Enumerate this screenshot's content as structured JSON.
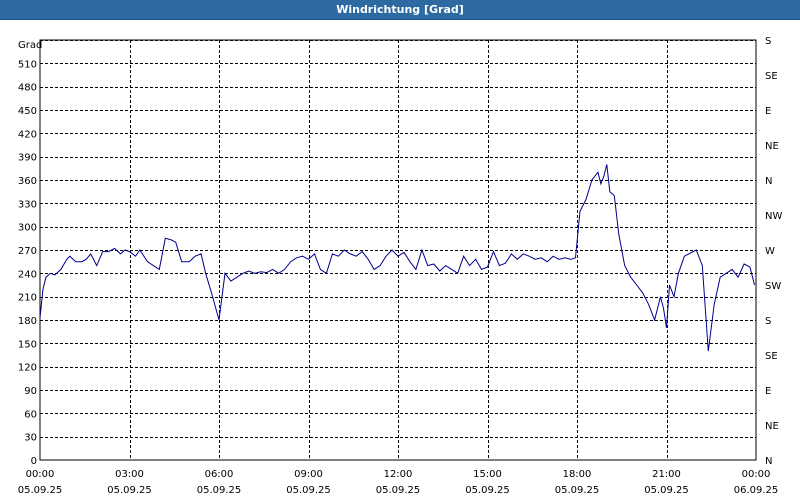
{
  "window": {
    "title": "Windrichtung [Grad]"
  },
  "chart_data": {
    "type": "line",
    "title": "Windrichtung [Grad]",
    "ylabel": "Grad",
    "ylim": [
      0,
      540
    ],
    "yticks": [
      0,
      30,
      60,
      90,
      120,
      150,
      180,
      210,
      240,
      270,
      300,
      330,
      360,
      390,
      420,
      450,
      480,
      510
    ],
    "right_axis_labels": [
      {
        "value": 0,
        "label": "N"
      },
      {
        "value": 45,
        "label": "NE"
      },
      {
        "value": 90,
        "label": "E"
      },
      {
        "value": 135,
        "label": "SE"
      },
      {
        "value": 180,
        "label": "S"
      },
      {
        "value": 225,
        "label": "SW"
      },
      {
        "value": 270,
        "label": "W"
      },
      {
        "value": 315,
        "label": "NW"
      },
      {
        "value": 360,
        "label": "N"
      },
      {
        "value": 405,
        "label": "NE"
      },
      {
        "value": 450,
        "label": "E"
      },
      {
        "value": 495,
        "label": "SE"
      },
      {
        "value": 540,
        "label": "S"
      }
    ],
    "xlim": [
      0,
      24
    ],
    "xticks": [
      {
        "hour": 0,
        "time": "00:00",
        "date": "05.09.25"
      },
      {
        "hour": 3,
        "time": "03:00",
        "date": "05.09.25"
      },
      {
        "hour": 6,
        "time": "06:00",
        "date": "05.09.25"
      },
      {
        "hour": 9,
        "time": "09:00",
        "date": "05.09.25"
      },
      {
        "hour": 12,
        "time": "12:00",
        "date": "05.09.25"
      },
      {
        "hour": 15,
        "time": "15:00",
        "date": "05.09.25"
      },
      {
        "hour": 18,
        "time": "18:00",
        "date": "05.09.25"
      },
      {
        "hour": 21,
        "time": "21:00",
        "date": "05.09.25"
      },
      {
        "hour": 24,
        "time": "00:00",
        "date": "06.09.25"
      }
    ],
    "grid": true,
    "series": [
      {
        "color": "#00008b",
        "x": [
          0,
          0.1,
          0.2,
          0.35,
          0.5,
          0.7,
          0.9,
          1.0,
          1.2,
          1.4,
          1.55,
          1.7,
          1.9,
          2.1,
          2.3,
          2.5,
          2.7,
          2.85,
          3.0,
          3.2,
          3.35,
          3.6,
          3.8,
          4.0,
          4.2,
          4.4,
          4.55,
          4.75,
          5.0,
          5.2,
          5.4,
          5.55,
          5.75,
          6.0,
          6.2,
          6.4,
          6.6,
          6.8,
          7.0,
          7.2,
          7.4,
          7.6,
          7.8,
          8.0,
          8.2,
          8.4,
          8.6,
          8.8,
          9.0,
          9.2,
          9.4,
          9.6,
          9.8,
          10.0,
          10.2,
          10.4,
          10.6,
          10.8,
          11.0,
          11.2,
          11.4,
          11.6,
          11.8,
          12.0,
          12.2,
          12.4,
          12.6,
          12.8,
          13.0,
          13.2,
          13.4,
          13.6,
          13.8,
          14.0,
          14.2,
          14.4,
          14.6,
          14.8,
          15.0,
          15.2,
          15.4,
          15.6,
          15.8,
          16.0,
          16.2,
          16.4,
          16.6,
          16.8,
          17.0,
          17.2,
          17.4,
          17.6,
          17.8,
          17.95,
          18.1,
          18.3,
          18.5,
          18.7,
          18.8,
          18.9,
          19.0,
          19.1,
          19.25,
          19.4,
          19.6,
          19.8,
          20.0,
          20.2,
          20.4,
          20.6,
          20.8,
          20.9,
          21.0,
          21.1,
          21.25,
          21.4,
          21.6,
          21.8,
          22.0,
          22.2,
          22.4,
          22.6,
          22.8,
          23.0,
          23.2,
          23.4,
          23.6,
          23.8,
          23.95
        ],
        "y": [
          183,
          220,
          235,
          240,
          238,
          245,
          258,
          262,
          255,
          255,
          258,
          265,
          250,
          268,
          268,
          272,
          265,
          270,
          268,
          262,
          270,
          255,
          250,
          245,
          285,
          283,
          280,
          255,
          255,
          262,
          265,
          240,
          215,
          180,
          240,
          230,
          235,
          240,
          243,
          240,
          242,
          241,
          245,
          240,
          245,
          255,
          260,
          262,
          258,
          265,
          245,
          240,
          265,
          262,
          270,
          265,
          262,
          268,
          258,
          245,
          250,
          262,
          270,
          262,
          267,
          255,
          245,
          270,
          250,
          252,
          243,
          250,
          245,
          240,
          262,
          250,
          258,
          245,
          248,
          268,
          250,
          253,
          265,
          258,
          265,
          262,
          258,
          260,
          255,
          262,
          258,
          260,
          258,
          260,
          320,
          335,
          360,
          370,
          355,
          365,
          380,
          345,
          340,
          290,
          250,
          235,
          225,
          215,
          200,
          180,
          210,
          195,
          170,
          225,
          210,
          240,
          262,
          266,
          270,
          250,
          140,
          200,
          235,
          240,
          245,
          235,
          252,
          248,
          225
        ]
      }
    ]
  }
}
